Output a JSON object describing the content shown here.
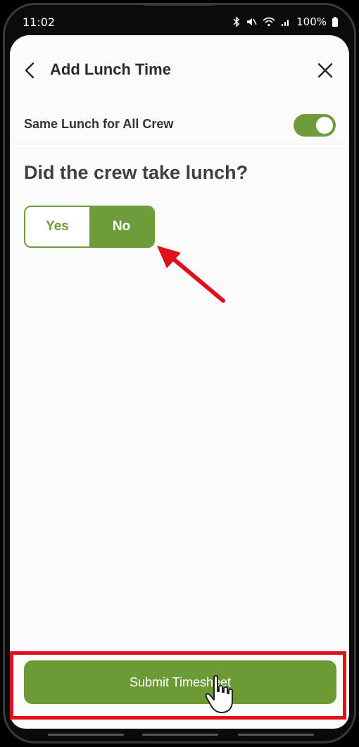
{
  "status_bar": {
    "time": "11:02",
    "battery": "100%"
  },
  "header": {
    "title": "Add Lunch Time"
  },
  "settings": {
    "same_lunch_label": "Same Lunch for All Crew",
    "same_lunch_enabled": true
  },
  "question": {
    "text": "Did the crew take lunch?"
  },
  "answer": {
    "yes_label": "Yes",
    "no_label": "No",
    "selected": "No"
  },
  "footer": {
    "submit_label": "Submit Timesheet"
  },
  "colors": {
    "accent": "#6e9c3a",
    "annotation": "#e0101a"
  },
  "icons": [
    "back-icon",
    "close-icon",
    "bluetooth-icon",
    "mute-icon",
    "wifi-icon",
    "signal-icon",
    "battery-icon",
    "hand-pointer-icon"
  ]
}
